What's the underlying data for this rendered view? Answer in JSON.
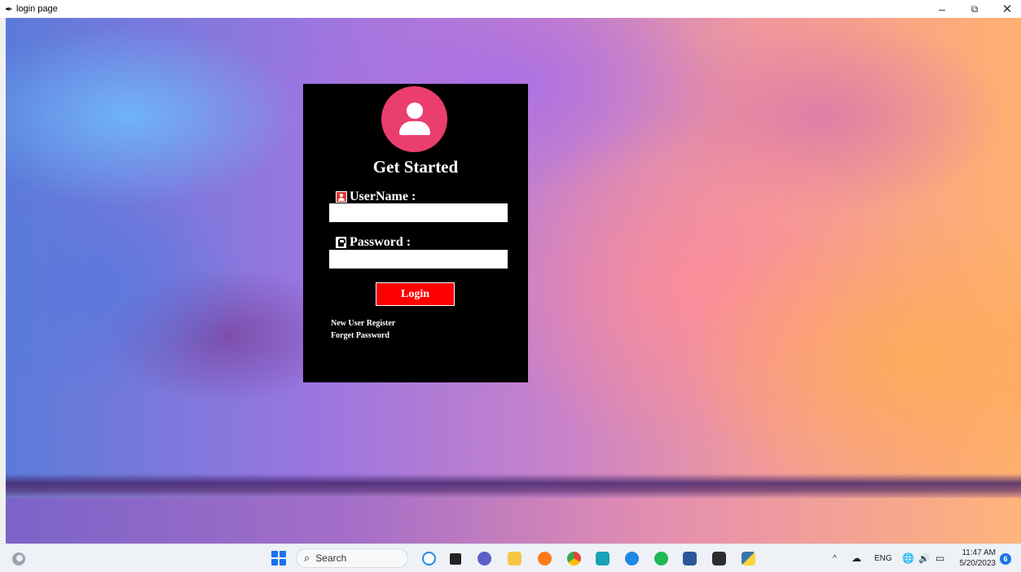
{
  "window": {
    "title": "login page",
    "minimize_glyph": "–",
    "maximize_glyph": "⧉",
    "close_glyph": "✕"
  },
  "login": {
    "heading": "Get Started",
    "username_label": "UserName :",
    "username_value": "",
    "password_label": "Password :",
    "password_value": "",
    "login_button": "Login",
    "register_link": "New User Register",
    "forgot_link": "Forget Password",
    "accent_color": "#ff0000",
    "avatar_color": "#ea3f6e"
  },
  "taskbar": {
    "search_label": "Search",
    "apps": [
      "bing-icon",
      "file-explorer-icon",
      "teams-chat-icon",
      "folder-icon",
      "firefox-icon",
      "chrome-icon",
      "app-icon",
      "edge-icon",
      "spotify-icon",
      "word-icon",
      "terminal-icon",
      "python-icon"
    ],
    "tray": {
      "chevron": "^",
      "language": "ENG",
      "time": "11:47 AM",
      "date": "5/20/2023",
      "notifications": "6"
    }
  }
}
